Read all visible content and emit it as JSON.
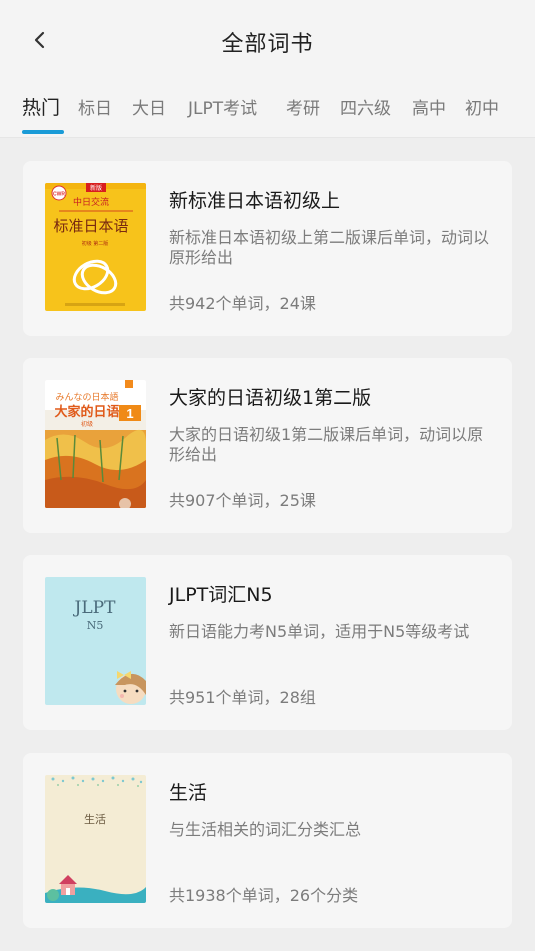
{
  "header": {
    "title": "全部词书",
    "back_icon": "chevron-left-icon"
  },
  "tabs": [
    {
      "label": "热门",
      "active": true
    },
    {
      "label": "标日"
    },
    {
      "label": "大日"
    },
    {
      "label": "JLPT考试"
    },
    {
      "label": "考研"
    },
    {
      "label": "四六级"
    },
    {
      "label": "高中"
    },
    {
      "label": "初中"
    }
  ],
  "accent_color": "#1a9bd7",
  "books": [
    {
      "title": "新标准日本语初级上",
      "description": "新标准日本语初级上第二版课后单词，动词以原形给出",
      "meta": "共942个单词，24课",
      "cover_text": {
        "top": "中日交流",
        "main": "标准日本语",
        "badge": "新版",
        "logo": "CWR",
        "edition": "初级 第二版"
      }
    },
    {
      "title": "大家的日语初级1第二版",
      "description": "大家的日语初级1第二版课后单词，动词以原形给出",
      "meta": "共907个单词，25课",
      "cover_text": {
        "jp": "みんなの日本語",
        "main": "大家的日语",
        "level": "初级",
        "number": "1"
      }
    },
    {
      "title": "JLPT词汇N5",
      "description": "新日语能力考N5单词，适用于N5等级考试",
      "meta": "共951个单词，28组",
      "cover_text": {
        "main": "JLPT",
        "sub": "N5"
      }
    },
    {
      "title": "生活",
      "description": "与生活相关的词汇分类汇总",
      "meta": "共1938个单词，26个分类",
      "cover_text": {
        "main": "生活"
      }
    }
  ]
}
